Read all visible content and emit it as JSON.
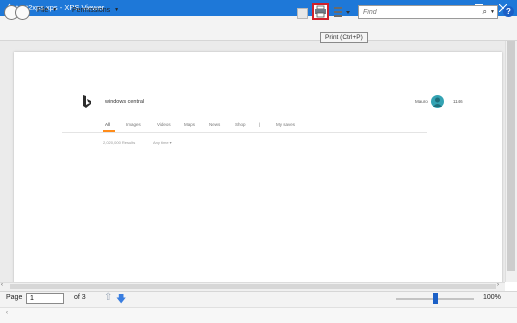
{
  "window": {
    "title": "test2xps.xps - XPS Viewer",
    "buttons": [
      "minimize",
      "maximize",
      "close"
    ]
  },
  "toolbar": {
    "menus": [
      {
        "label": "File"
      },
      {
        "label": "Permissions"
      }
    ],
    "find_placeholder": "Find",
    "print_tooltip": "Print (Ctrl+P)",
    "accent_color": "#1e78d8",
    "highlight_color": "#d0202a"
  },
  "document": {
    "search_query": "windows central",
    "user_name": "Mauro",
    "reward_count": "1146",
    "tabs": [
      "All",
      "Images",
      "Videos",
      "Maps",
      "News",
      "Shop",
      "|",
      "My saves"
    ],
    "results_count": "2,020,000 Results",
    "time_filter": "Any time ▾"
  },
  "status": {
    "page_label": "Page",
    "current_page": "1",
    "page_of": "of 3",
    "zoom_level": "100%",
    "zoom_fraction": 0.5
  }
}
